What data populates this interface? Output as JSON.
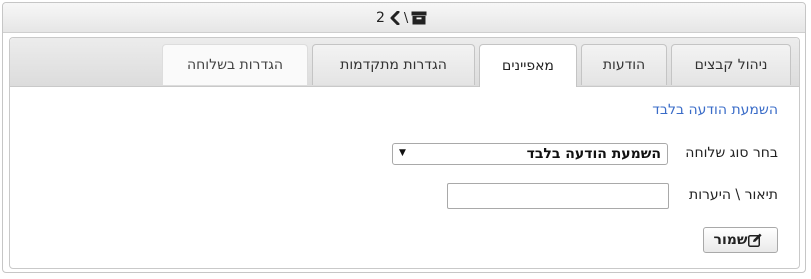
{
  "breadcrumb": {
    "level": "2",
    "separator": "\\",
    "icons": [
      "chevron-left-icon",
      "archive-box-icon"
    ]
  },
  "tabs": [
    {
      "label": "ניהול קבצים",
      "active": false
    },
    {
      "label": "הודעות",
      "active": false
    },
    {
      "label": "מאפיינים",
      "active": true
    },
    {
      "label": "הגדרות מתקדמות",
      "active": false
    },
    {
      "label": "הגדרות בשלוחה",
      "active": false
    }
  ],
  "form": {
    "section_title": "השמעת הודעה בלבד",
    "type_label": "בחר סוג שלוחה",
    "type_value": "השמעת הודעה בלבד",
    "description_label": "תיאור \\ היערות",
    "description_value": "",
    "save_label": "שמור"
  },
  "colors": {
    "link": "#3a6cc8"
  }
}
